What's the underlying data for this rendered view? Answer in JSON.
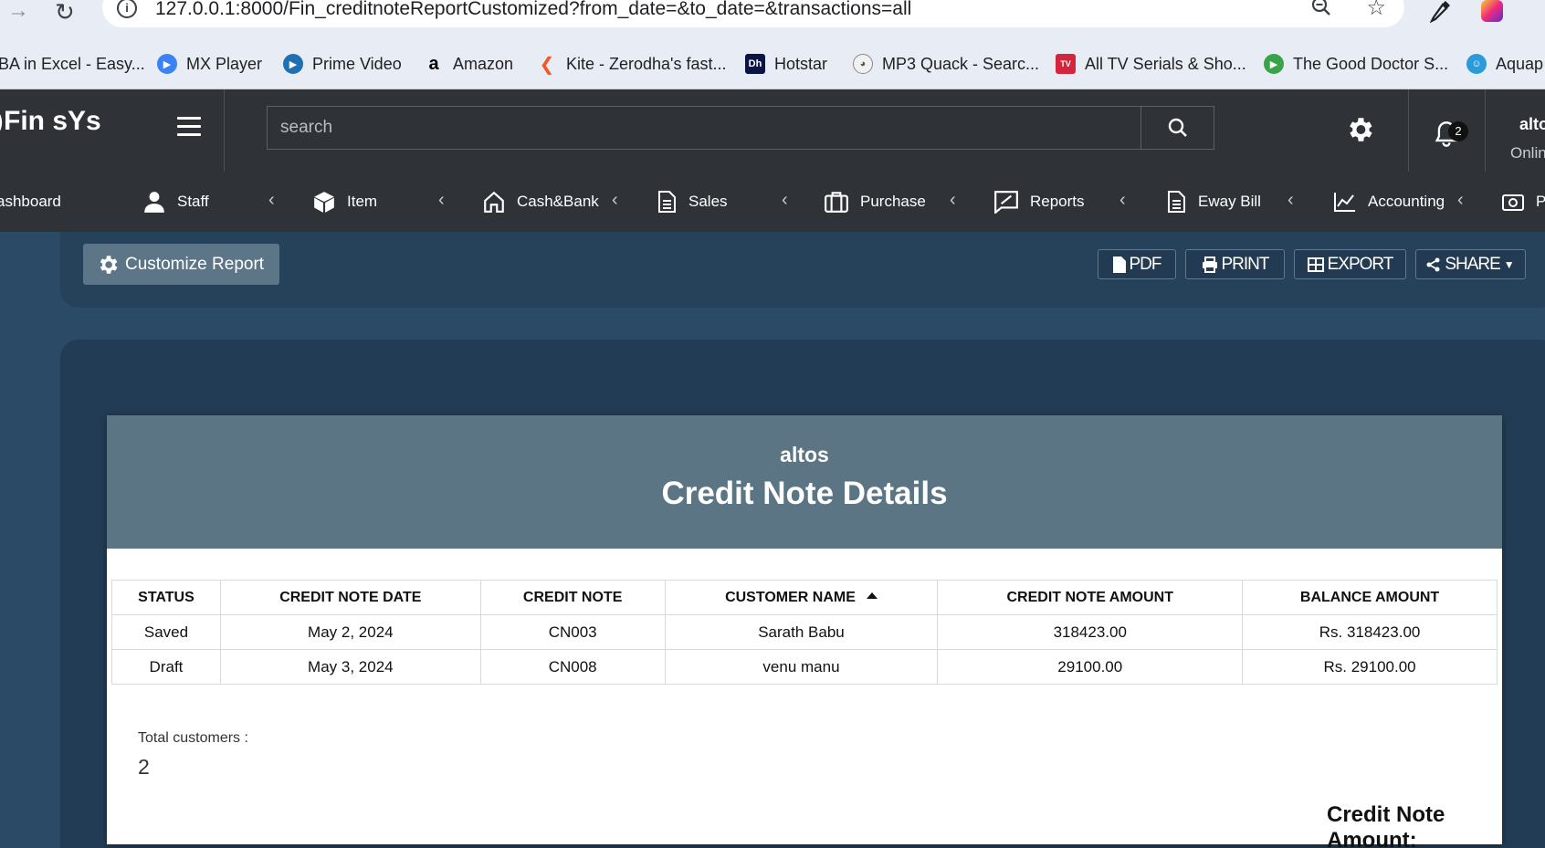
{
  "browser": {
    "url": "127.0.0.1:8000/Fin_creditnoteReportCustomized?from_date=&to_date=&transactions=all",
    "bookmarks": [
      {
        "label": "BA in Excel - Easy...",
        "icon": "excel-icon",
        "color": "#1d6f42"
      },
      {
        "label": "MX Player",
        "icon": "mx-player-icon",
        "color": "#3b82f6"
      },
      {
        "label": "Prime Video",
        "icon": "prime-video-icon",
        "color": "#1f6fb2"
      },
      {
        "label": "Amazon",
        "icon": "amazon-icon",
        "color": "#000000"
      },
      {
        "label": "Kite - Zerodha's fast...",
        "icon": "kite-icon",
        "color": "#f0582a"
      },
      {
        "label": "Hotstar",
        "icon": "hotstar-icon",
        "color": "#0c1445"
      },
      {
        "label": "MP3 Quack - Searc...",
        "icon": "mp3-quack-icon",
        "color": "#888888"
      },
      {
        "label": "All TV Serials & Sho...",
        "icon": "tv-serials-icon",
        "color": "#d3263c"
      },
      {
        "label": "The Good Doctor S...",
        "icon": "good-doctor-icon",
        "color": "#3aa34a"
      },
      {
        "label": "Aquap",
        "icon": "aquap-icon",
        "color": "#2a9bd8"
      }
    ]
  },
  "header": {
    "logo": "Fin sYs",
    "search_placeholder": "search",
    "notification_count": "2",
    "user_name": "alto",
    "user_status": "Onlin"
  },
  "nav": {
    "items": [
      {
        "label": "ashboard",
        "icon": "dashboard-icon"
      },
      {
        "label": "Staff",
        "icon": "user-icon"
      },
      {
        "label": "Item",
        "icon": "box-icon"
      },
      {
        "label": "Cash&Bank",
        "icon": "home-icon"
      },
      {
        "label": "Sales",
        "icon": "file-icon"
      },
      {
        "label": "Purchase",
        "icon": "briefcase-icon"
      },
      {
        "label": "Reports",
        "icon": "report-icon"
      },
      {
        "label": "Eway Bill",
        "icon": "file-icon"
      },
      {
        "label": "Accounting",
        "icon": "chart-line-icon"
      },
      {
        "label": "P",
        "icon": "camera-icon"
      }
    ]
  },
  "toolbar": {
    "customize_label": "Customize Report",
    "pdf_label": "PDF",
    "print_label": "PRINT",
    "export_label": "EXPORT",
    "share_label": "SHARE"
  },
  "report": {
    "company": "altos",
    "title": "Credit Note Details",
    "columns": [
      "STATUS",
      "CREDIT NOTE DATE",
      "CREDIT NOTE",
      "CUSTOMER NAME",
      "CREDIT NOTE AMOUNT",
      "BALANCE AMOUNT"
    ],
    "rows": [
      [
        "Saved",
        "May 2, 2024",
        "CN003",
        "Sarath Babu",
        "318423.00",
        "Rs. 318423.00"
      ],
      [
        "Draft",
        "May 3, 2024",
        "CN008",
        "venu manu",
        "29100.00",
        "Rs. 29100.00"
      ]
    ],
    "total_customers_label": "Total customers :",
    "total_customers_value": "2",
    "credit_note_amount_label": "Credit Note Amount:"
  },
  "colors": {
    "page_bg": "#2b4a66",
    "header_bg": "#2f3338",
    "sheet_header": "#5c7584",
    "customize_button": "#5c7687"
  }
}
